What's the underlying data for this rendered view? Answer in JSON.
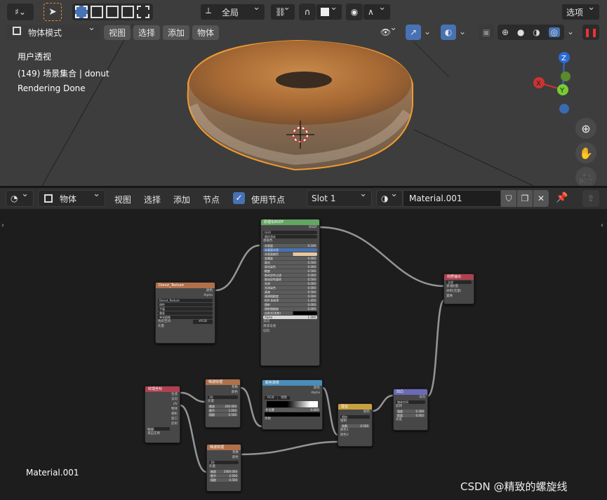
{
  "viewport": {
    "header": {
      "mode_label": "物体模式",
      "menus": [
        "视图",
        "选择",
        "添加",
        "物体"
      ],
      "transform_orientation": "全局",
      "options_label": "选项"
    },
    "overlay": {
      "view_name": "用户透视",
      "collection": "(149) 场景集合 | donut",
      "status": "Rendering Done"
    },
    "gizmo": {
      "x": "X",
      "y": "Y",
      "z": "Z"
    }
  },
  "node_editor": {
    "header": {
      "object_type": "物体",
      "menus": [
        "视图",
        "选择",
        "添加",
        "节点"
      ],
      "use_nodes_label": "使用节点",
      "slot": "Slot 1",
      "material_name": "Material.001"
    },
    "material_label": "Material.001",
    "watermark": "CSDN @精致的螺旋线",
    "nodes": {
      "bsdf": {
        "title": "原理化BSDF",
        "output": "BSDF",
        "dist": "GGX",
        "subsurface_method": "随机游走",
        "rows": [
          "基础色",
          "次表面",
          "次表面半径",
          "次表面颜色",
          "金属度",
          "高光",
          "高光染色",
          "糙度",
          "各向异性过滤",
          "各向异性旋转",
          "光泽",
          "光泽染色",
          "清漆",
          "清漆粗糙度",
          "IOR 折射率",
          "透射",
          "透射粗糙度",
          "自发光(发射)",
          "Alpha",
          "法向",
          "清漆法线",
          "切向"
        ],
        "values": [
          "0.100",
          "0.000",
          "0.500",
          "0.000",
          "0.500",
          "0.000",
          "0.500",
          "0.000",
          "0.000",
          "0.500",
          "0.000",
          "0.030",
          "1.450",
          "0.000",
          "0.000",
          "1.000"
        ]
      },
      "texture": {
        "title": "Donut_Texture",
        "out1": "颜色",
        "out2": "Alpha",
        "image": "Donut_Texture",
        "opts": [
          "线性",
          "平展",
          "重复",
          "单张图像"
        ],
        "color_space_label": "色彩空间",
        "color_space": "sRGB",
        "vector": "矢量"
      },
      "output": {
        "title": "材质输出",
        "target": "全部",
        "rows": [
          "表(曲)面",
          "体积(音量)",
          "置换"
        ]
      },
      "texcoord": {
        "title": "纹理坐标",
        "rows": [
          "生成",
          "法向",
          "UV",
          "物体",
          "相机",
          "窗口",
          "反射"
        ],
        "object_label": "物体",
        "from_instancer": "来自实例"
      },
      "noise1": {
        "title": "噪波纹理",
        "outs": [
          "系数",
          "颜色"
        ],
        "dim": "3D",
        "vec": "矢量",
        "rows": [
          "缩放",
          "细节",
          "粗糙"
        ],
        "values": [
          "200.000",
          "2.000",
          "0.500"
        ]
      },
      "noise2": {
        "title": "噪波纹理",
        "outs": [
          "系数",
          "颜色"
        ],
        "dim": "3D",
        "vec": "矢量",
        "rows": [
          "缩放",
          "细节",
          "粗糙"
        ],
        "values": [
          "2000.000",
          "2.000",
          "0.500"
        ]
      },
      "ramp": {
        "title": "颜色渐变",
        "outs": [
          "颜色",
          "Alpha"
        ],
        "mode": "RGB",
        "interp": "线性",
        "stop": "0",
        "pos_label": "位置",
        "pos_value": "0.000",
        "factor": "系数"
      },
      "mix": {
        "title": "混合",
        "out": "颜色",
        "mode": "相加",
        "clamp": "钳制",
        "factor_label": "系数",
        "factor": "0.500",
        "c1": "颜色1",
        "c2": "颜色2"
      },
      "bump": {
        "title": "凹凸",
        "out": "法向",
        "invert": "反转",
        "rows": [
          "强度",
          "距离"
        ],
        "values": [
          "0.300",
          "0.002"
        ],
        "height": "高度",
        "normal": "法向",
        "mode": "物体空间"
      }
    }
  }
}
